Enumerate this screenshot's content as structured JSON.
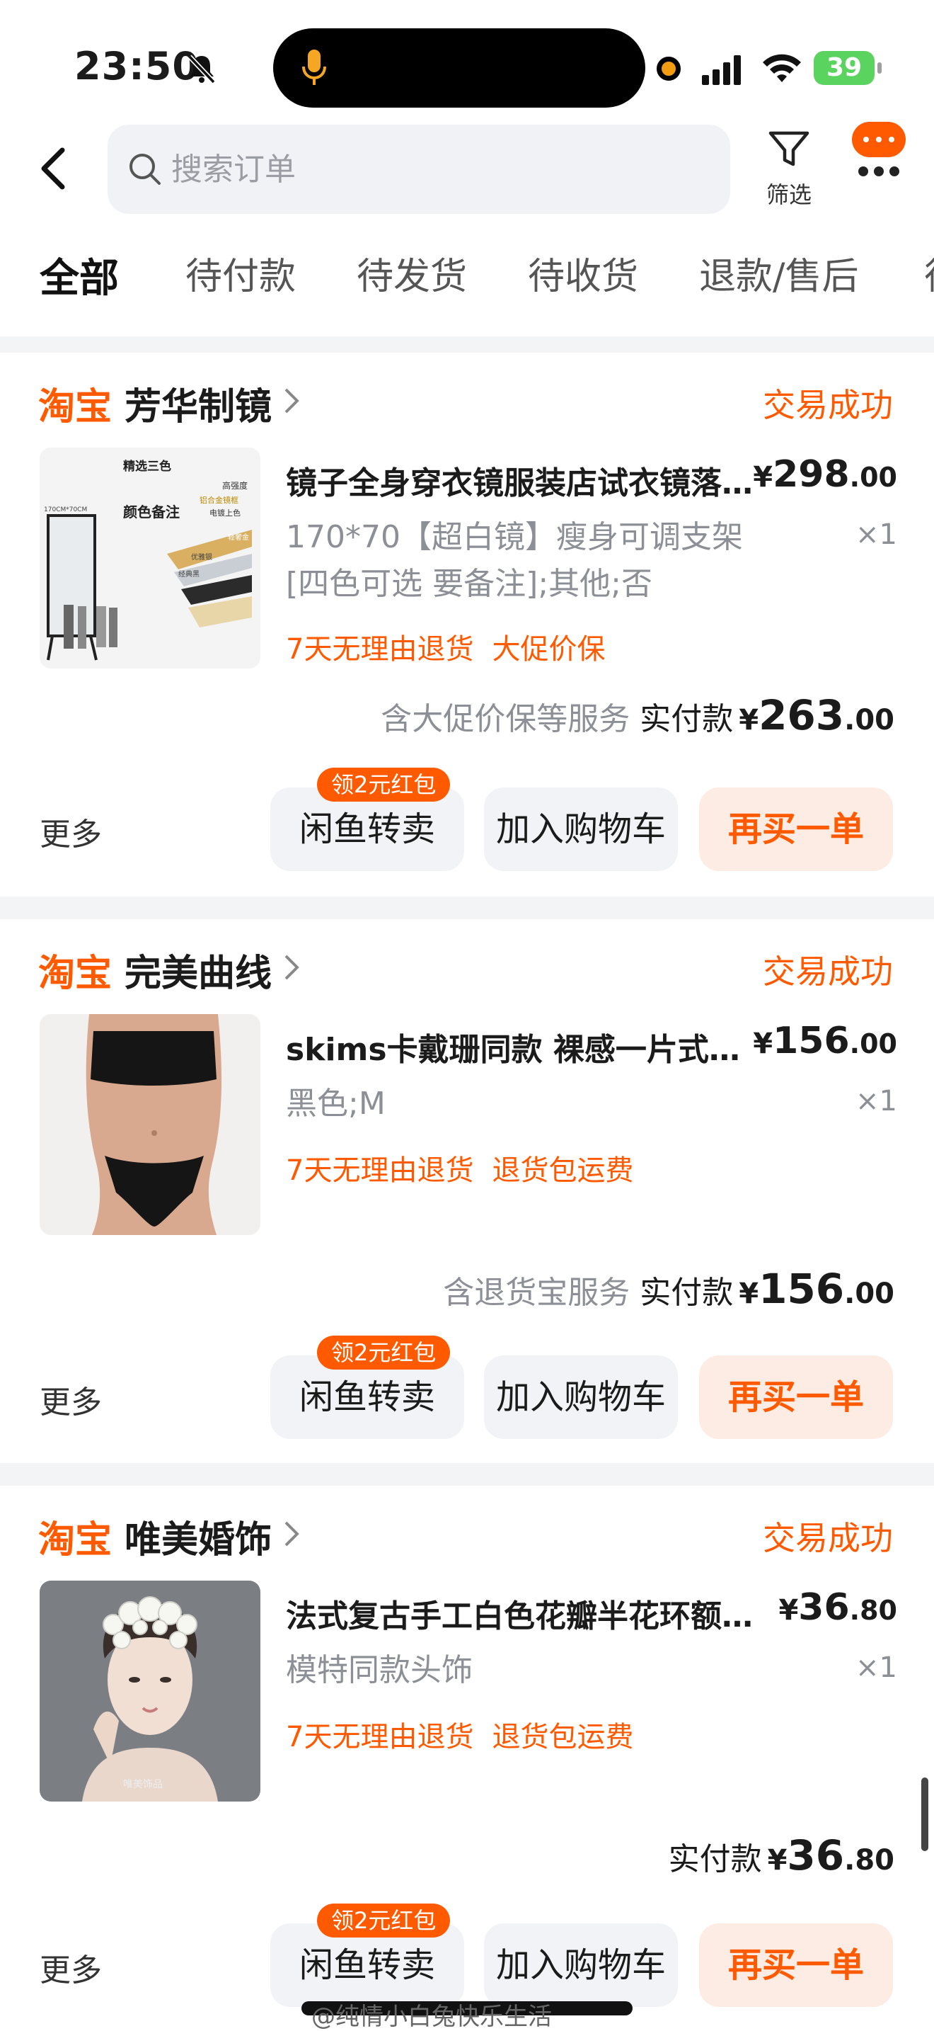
{
  "status_bar": {
    "time": "23:50",
    "battery": "39"
  },
  "header": {
    "search_placeholder": "搜索订单",
    "filter_label": "筛选"
  },
  "tabs": [
    {
      "label": "全部",
      "active": true
    },
    {
      "label": "待付款"
    },
    {
      "label": "待发货"
    },
    {
      "label": "待收货"
    },
    {
      "label": "退款/售后"
    }
  ],
  "orders": [
    {
      "platform": "淘宝",
      "shop": "芳华制镜",
      "status": "交易成功",
      "title": "镜子全身穿衣镜服装店试衣镜落地镜家用",
      "price_yen": "¥",
      "price_int": "298",
      "price_dec": ".00",
      "variant": "170*70【超白镜】瘦身可调支架 [四色可选 要备注];其他;否",
      "qty": "×1",
      "tags": [
        "7天无理由退货",
        "大促价保"
      ],
      "service": "含大促价保等服务",
      "pay_label": "实付款",
      "pay_yen": "¥",
      "pay_int": "263",
      "pay_dec": ".00",
      "more": "更多",
      "badge": "领2元红包",
      "buttons": [
        "闲鱼转卖",
        "加入购物车",
        "再买一单"
      ],
      "image": {
        "line1": "精选三色",
        "line2": "颜色备注",
        "line3": "高强度",
        "line4": "铝合金镜框",
        "line5": "电镀上色",
        "line6": "轻奢金",
        "line7": "优雅银",
        "line8": "经典黑",
        "line9": "170CM*70CM"
      }
    },
    {
      "platform": "淘宝",
      "shop": "完美曲线",
      "status": "交易成功",
      "title": "skims卡戴珊同款 裸感一片式抹胸内衣套装",
      "price_yen": "¥",
      "price_int": "156",
      "price_dec": ".00",
      "variant": "黑色;M",
      "qty": "×1",
      "tags": [
        "7天无理由退货",
        "退货包运费"
      ],
      "service": "含退货宝服务",
      "pay_label": "实付款",
      "pay_yen": "¥",
      "pay_int": "156",
      "pay_dec": ".00",
      "more": "更多",
      "badge": "领2元红包",
      "buttons": [
        "闲鱼转卖",
        "加入购物车",
        "再买一单"
      ]
    },
    {
      "platform": "淘宝",
      "shop": "唯美婚饰",
      "status": "交易成功",
      "title": "法式复古手工白色花瓣半花环额饰新娘头饰",
      "price_yen": "¥",
      "price_int": "36",
      "price_dec": ".80",
      "variant": "模特同款头饰",
      "qty": "×1",
      "tags": [
        "7天无理由退货",
        "退货包运费"
      ],
      "service": "",
      "pay_label": "实付款",
      "pay_yen": "¥",
      "pay_int": "36",
      "pay_dec": ".80",
      "more": "更多",
      "badge": "领2元红包",
      "buttons": [
        "闲鱼转卖",
        "加入购物车",
        "再买一单"
      ],
      "image": {
        "watermark": "唯美饰品"
      }
    }
  ],
  "watermark": "@纯情小白兔快乐生活",
  "colors": {
    "accent": "#ff5a00",
    "primary_btn_bg": "#fdece3",
    "page_bg": "#f3f4f6"
  }
}
